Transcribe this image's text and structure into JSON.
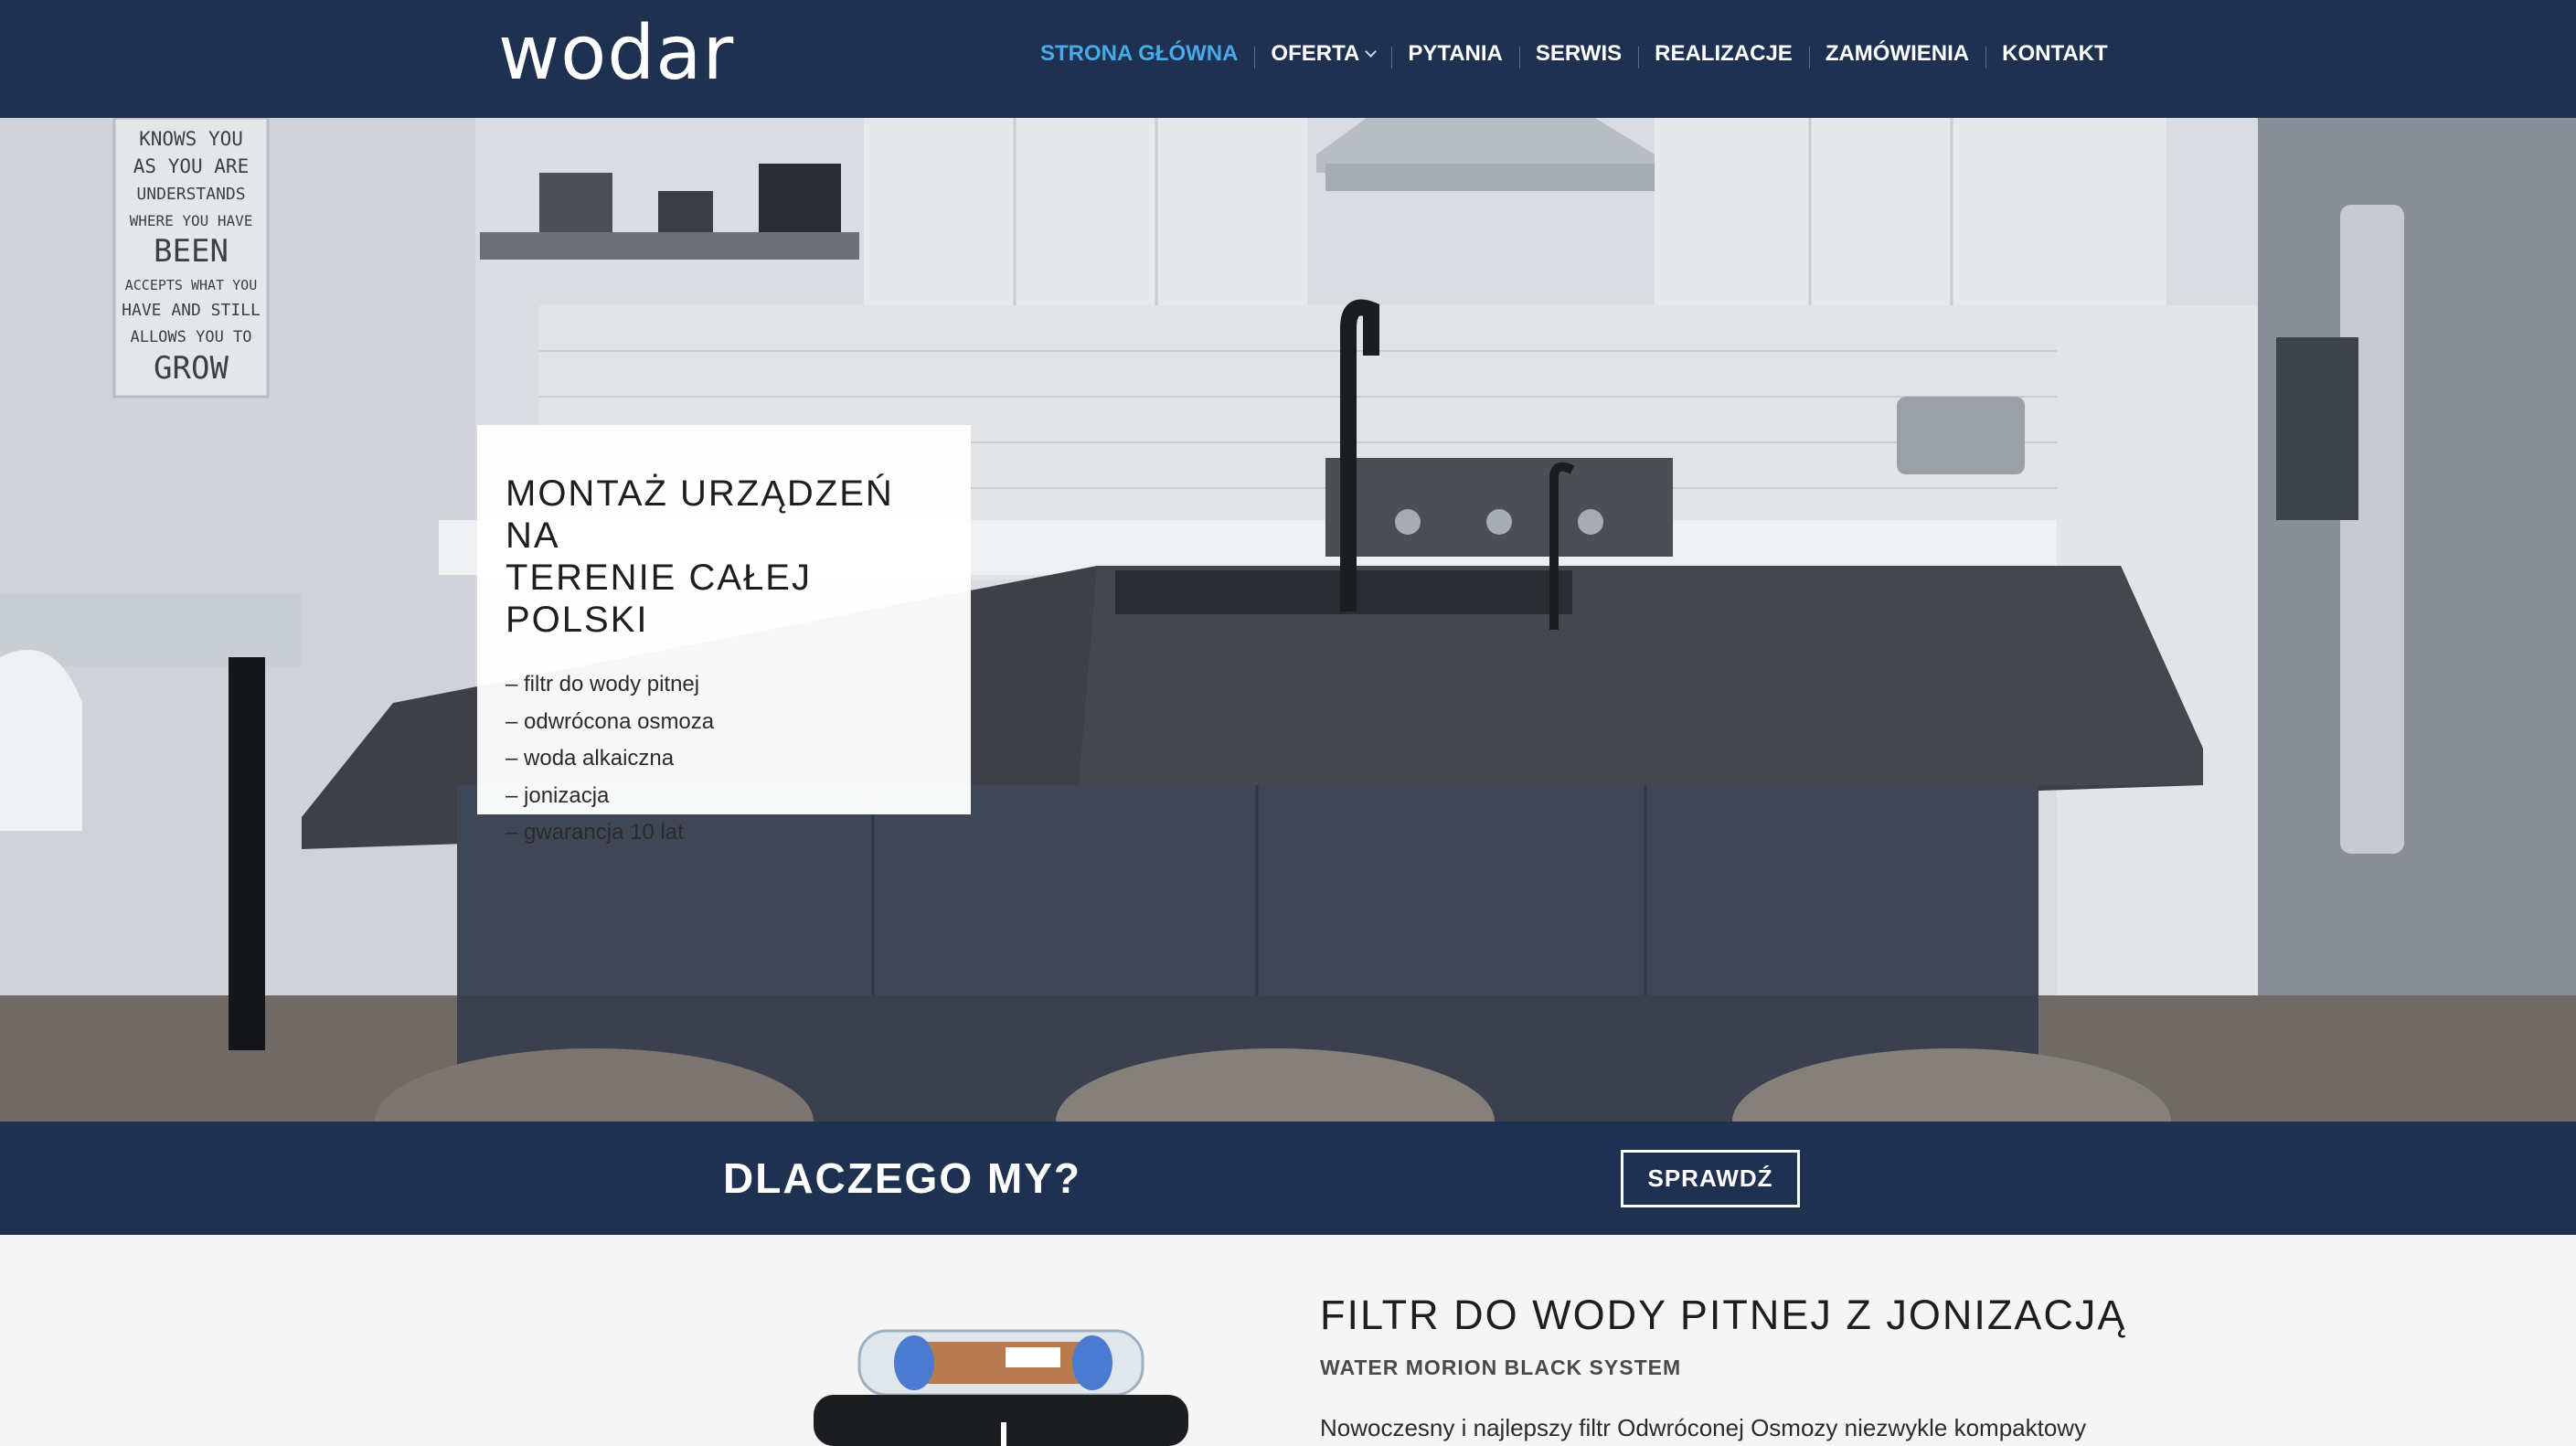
{
  "header": {
    "logo": "wodar",
    "nav": [
      {
        "label": "STRONA GŁÓWNA",
        "active": true
      },
      {
        "label": "OFERTA",
        "has_dropdown": true
      },
      {
        "label": "PYTANIA"
      },
      {
        "label": "SERWIS"
      },
      {
        "label": "REALIZACJE"
      },
      {
        "label": "ZAMÓWIENIA"
      },
      {
        "label": "KONTAKT"
      }
    ]
  },
  "hero": {
    "title_line1": "MONTAŻ URZĄDZEŃ NA",
    "title_line2": "TERENIE CAŁEJ POLSKI",
    "items": [
      "– filtr do wody pitnej",
      "– odwrócona osmoza",
      "– woda alkaiczna",
      "– jonizacja",
      "– gwarancja 10 lat"
    ],
    "poster_lines": [
      "KNOWS YOU",
      "AS YOU ARE",
      "UNDERSTANDS",
      "WHERE YOU HAVE",
      "BEEN",
      "ACCEPTS WHAT YOU",
      "HAVE AND STILL",
      "ALLOWS YOU TO",
      "GROW"
    ]
  },
  "why": {
    "title": "DLACZEGO MY?",
    "button": "SPRAWDŹ"
  },
  "product": {
    "title": "FILTR DO WODY PITNEJ Z JONIZACJĄ",
    "subtitle": "WATER MORION BLACK SYSTEM",
    "description": "Nowoczesny i najlepszy filtr Odwróconej Osmozy niezwykle kompaktowy"
  },
  "colors": {
    "header_bg": "#1f3150",
    "nav_active": "#47a9e8",
    "text_dark": "#1e1e1e"
  }
}
